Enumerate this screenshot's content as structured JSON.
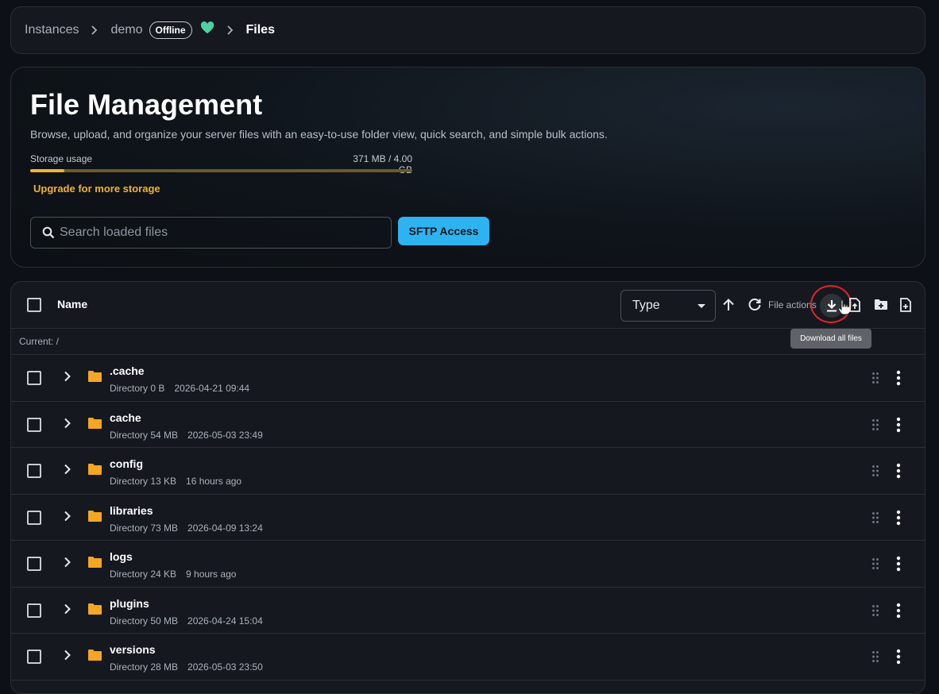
{
  "breadcrumb": {
    "items": [
      "Instances",
      "demo",
      "Files"
    ],
    "badge": "Offline"
  },
  "hero": {
    "title": "File Management",
    "description": "Browse, upload, and organize your server files with an easy-to-use folder view, quick search, and simple bulk actions.",
    "storage_label": "Storage usage",
    "storage_value": "371 MB / 4.00 GB",
    "storage_fraction": 0.09,
    "upgrade_label": "Upgrade for more storage",
    "search_placeholder": "Search loaded files",
    "sftp_label": "SFTP Access"
  },
  "table": {
    "header_name": "Name",
    "sort_select": "Type",
    "file_actions_label": "File actions",
    "tooltip": "Download all files",
    "current_path": "Current: /",
    "rows": [
      {
        "name": ".cache",
        "type": "Directory",
        "size": "0 B",
        "modified": "2026-04-21 09:44"
      },
      {
        "name": "cache",
        "type": "Directory",
        "size": "54 MB",
        "modified": "2026-05-03 23:49"
      },
      {
        "name": "config",
        "type": "Directory",
        "size": "13 KB",
        "modified": "16 hours ago"
      },
      {
        "name": "libraries",
        "type": "Directory",
        "size": "73 MB",
        "modified": "2026-04-09 13:24"
      },
      {
        "name": "logs",
        "type": "Directory",
        "size": "24 KB",
        "modified": "9 hours ago"
      },
      {
        "name": "plugins",
        "type": "Directory",
        "size": "50 MB",
        "modified": "2026-04-24 15:04"
      },
      {
        "name": "versions",
        "type": "Directory",
        "size": "28 MB",
        "modified": "2026-05-03 23:50"
      }
    ]
  },
  "colors": {
    "accent": "#2db3f0",
    "warning": "#f2b233",
    "folder": "#f5a623",
    "status_heart": "#4fd1a5"
  }
}
